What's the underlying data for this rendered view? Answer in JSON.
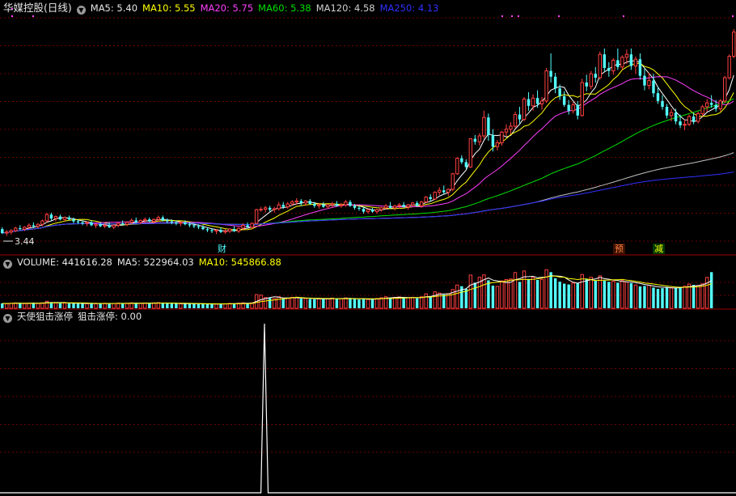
{
  "colors": {
    "bg": "#000000",
    "grid": "#6e0000",
    "separator": "#a00000",
    "up": "#ff4040",
    "down": "#54ffff",
    "ma5": "#ffffff",
    "ma10": "#ffff00",
    "ma20": "#ff40ff",
    "ma60": "#00e000",
    "ma120": "#c0c0c0",
    "ma250": "#3030ff",
    "signal": "#ffffff"
  },
  "price_panel": {
    "title": "华媒控股(日线)",
    "icon": "chevron-down-icon",
    "ma_labels": [
      {
        "text": "MA5: 5.40",
        "color": "#e6e6e6"
      },
      {
        "text": "MA10: 5.55",
        "color": "#ffff00"
      },
      {
        "text": "MA20: 5.75",
        "color": "#ff40ff"
      },
      {
        "text": "MA60: 5.38",
        "color": "#00e000"
      },
      {
        "text": "MA120: 4.58",
        "color": "#d0d0d0"
      },
      {
        "text": "MA250: 4.13",
        "color": "#3030ff"
      }
    ],
    "low_label": "3.44",
    "tags": [
      {
        "text": "财",
        "color": "#54ffff",
        "bg": "#000000",
        "index": 49
      },
      {
        "text": "预",
        "color": "#ff8040",
        "bg": "#3a1000",
        "index": 138
      },
      {
        "text": "减",
        "color": "#ffff00",
        "bg": "#003a00",
        "index": 147
      }
    ]
  },
  "volume_panel": {
    "labels": [
      {
        "text": "VOLUME: 441616.28",
        "color": "#e6e6e6"
      },
      {
        "text": "MA5: 522964.03",
        "color": "#e6e6e6"
      },
      {
        "text": "MA10: 545866.88",
        "color": "#ffff00"
      }
    ]
  },
  "indicator_panel": {
    "name": "天使狙击涨停",
    "labels": [
      {
        "text": "狙击涨停: 0.00",
        "color": "#e6e6e6"
      }
    ]
  },
  "chart_data": {
    "type": "candlestick",
    "ylim": [
      3.3,
      8.0
    ],
    "candles": [
      [
        3.58,
        3.62,
        3.48,
        3.5
      ],
      [
        3.5,
        3.56,
        3.44,
        3.52
      ],
      [
        3.52,
        3.58,
        3.47,
        3.55
      ],
      [
        3.55,
        3.63,
        3.52,
        3.6
      ],
      [
        3.6,
        3.66,
        3.56,
        3.58
      ],
      [
        3.58,
        3.64,
        3.54,
        3.62
      ],
      [
        3.62,
        3.7,
        3.58,
        3.66
      ],
      [
        3.66,
        3.72,
        3.6,
        3.64
      ],
      [
        3.64,
        3.7,
        3.6,
        3.68
      ],
      [
        3.68,
        3.78,
        3.64,
        3.75
      ],
      [
        3.75,
        3.92,
        3.72,
        3.88
      ],
      [
        3.88,
        3.92,
        3.76,
        3.8
      ],
      [
        3.8,
        3.86,
        3.74,
        3.84
      ],
      [
        3.84,
        3.88,
        3.76,
        3.78
      ],
      [
        3.78,
        3.84,
        3.74,
        3.82
      ],
      [
        3.82,
        3.86,
        3.76,
        3.78
      ],
      [
        3.78,
        3.82,
        3.7,
        3.74
      ],
      [
        3.74,
        3.78,
        3.68,
        3.72
      ],
      [
        3.72,
        3.76,
        3.66,
        3.7
      ],
      [
        3.7,
        3.74,
        3.64,
        3.72
      ],
      [
        3.72,
        3.76,
        3.64,
        3.66
      ],
      [
        3.66,
        3.7,
        3.6,
        3.68
      ],
      [
        3.68,
        3.72,
        3.62,
        3.64
      ],
      [
        3.64,
        3.7,
        3.6,
        3.66
      ],
      [
        3.66,
        3.72,
        3.6,
        3.62
      ],
      [
        3.62,
        3.68,
        3.58,
        3.66
      ],
      [
        3.66,
        3.72,
        3.62,
        3.7
      ],
      [
        3.7,
        3.76,
        3.66,
        3.68
      ],
      [
        3.68,
        3.74,
        3.64,
        3.72
      ],
      [
        3.72,
        3.8,
        3.68,
        3.76
      ],
      [
        3.76,
        3.82,
        3.7,
        3.72
      ],
      [
        3.72,
        3.78,
        3.68,
        3.76
      ],
      [
        3.76,
        3.82,
        3.72,
        3.78
      ],
      [
        3.78,
        3.82,
        3.72,
        3.74
      ],
      [
        3.74,
        3.8,
        3.7,
        3.78
      ],
      [
        3.78,
        3.86,
        3.74,
        3.82
      ],
      [
        3.82,
        3.86,
        3.74,
        3.76
      ],
      [
        3.76,
        3.8,
        3.7,
        3.74
      ],
      [
        3.74,
        3.78,
        3.68,
        3.72
      ],
      [
        3.72,
        3.76,
        3.66,
        3.7
      ],
      [
        3.7,
        3.74,
        3.64,
        3.72
      ],
      [
        3.72,
        3.76,
        3.66,
        3.68
      ],
      [
        3.68,
        3.72,
        3.62,
        3.66
      ],
      [
        3.66,
        3.7,
        3.6,
        3.64
      ],
      [
        3.64,
        3.68,
        3.58,
        3.62
      ],
      [
        3.62,
        3.66,
        3.56,
        3.58
      ],
      [
        3.58,
        3.62,
        3.52,
        3.56
      ],
      [
        3.56,
        3.6,
        3.5,
        3.54
      ],
      [
        3.54,
        3.58,
        3.48,
        3.56
      ],
      [
        3.56,
        3.62,
        3.5,
        3.52
      ],
      [
        3.52,
        3.58,
        3.48,
        3.54
      ],
      [
        3.54,
        3.6,
        3.5,
        3.58
      ],
      [
        3.58,
        3.64,
        3.52,
        3.54
      ],
      [
        3.54,
        3.62,
        3.5,
        3.6
      ],
      [
        3.6,
        3.7,
        3.56,
        3.66
      ],
      [
        3.66,
        3.72,
        3.6,
        3.62
      ],
      [
        3.62,
        3.72,
        3.58,
        3.7
      ],
      [
        3.7,
        4.0,
        3.68,
        3.98
      ],
      [
        3.98,
        4.04,
        3.94,
        3.99
      ],
      [
        3.99,
        4.06,
        3.92,
        4.02
      ],
      [
        4.02,
        4.06,
        3.94,
        3.98
      ],
      [
        3.98,
        4.04,
        3.92,
        4.0
      ],
      [
        4.0,
        4.14,
        3.96,
        4.08
      ],
      [
        4.08,
        4.14,
        4.0,
        4.04
      ],
      [
        4.04,
        4.14,
        4.0,
        4.1
      ],
      [
        4.1,
        4.18,
        4.06,
        4.14
      ],
      [
        4.14,
        4.22,
        4.08,
        4.16
      ],
      [
        4.16,
        4.2,
        4.06,
        4.12
      ],
      [
        4.12,
        4.18,
        4.06,
        4.16
      ],
      [
        4.16,
        4.2,
        4.08,
        4.1
      ],
      [
        4.1,
        4.14,
        4.02,
        4.06
      ],
      [
        4.06,
        4.12,
        4.0,
        4.08
      ],
      [
        4.08,
        4.14,
        4.02,
        4.04
      ],
      [
        4.04,
        4.1,
        4.0,
        4.08
      ],
      [
        4.08,
        4.14,
        4.02,
        4.1
      ],
      [
        4.1,
        4.16,
        4.04,
        4.06
      ],
      [
        4.06,
        4.12,
        4.02,
        4.08
      ],
      [
        4.08,
        4.18,
        4.04,
        4.14
      ],
      [
        4.14,
        4.18,
        4.04,
        4.06
      ],
      [
        4.06,
        4.1,
        3.98,
        4.02
      ],
      [
        4.02,
        4.06,
        3.96,
        4.0
      ],
      [
        4.0,
        4.04,
        3.9,
        3.94
      ],
      [
        3.94,
        4.0,
        3.9,
        3.98
      ],
      [
        3.98,
        4.02,
        3.92,
        3.94
      ],
      [
        3.94,
        4.0,
        3.9,
        3.98
      ],
      [
        3.98,
        4.04,
        3.94,
        4.02
      ],
      [
        4.02,
        4.1,
        3.98,
        4.06
      ],
      [
        4.06,
        4.14,
        4.0,
        4.02
      ],
      [
        4.02,
        4.08,
        3.96,
        4.06
      ],
      [
        4.06,
        4.12,
        4.0,
        4.08
      ],
      [
        4.08,
        4.14,
        4.02,
        4.04
      ],
      [
        4.04,
        4.1,
        3.98,
        4.08
      ],
      [
        4.08,
        4.14,
        4.04,
        4.12
      ],
      [
        4.12,
        4.16,
        4.04,
        4.06
      ],
      [
        4.06,
        4.16,
        4.02,
        4.14
      ],
      [
        4.14,
        4.26,
        4.12,
        4.24
      ],
      [
        4.24,
        4.3,
        4.16,
        4.2
      ],
      [
        4.2,
        4.36,
        4.18,
        4.34
      ],
      [
        4.34,
        4.44,
        4.28,
        4.38
      ],
      [
        4.38,
        4.48,
        4.3,
        4.34
      ],
      [
        4.34,
        4.42,
        4.26,
        4.4
      ],
      [
        4.4,
        4.74,
        4.36,
        4.72
      ],
      [
        4.72,
        5.06,
        4.7,
        5.04
      ],
      [
        5.04,
        5.1,
        4.92,
        4.96
      ],
      [
        4.96,
        5.02,
        4.82,
        4.86
      ],
      [
        4.86,
        5.46,
        4.84,
        5.44
      ],
      [
        5.44,
        5.52,
        5.32,
        5.38
      ],
      [
        5.38,
        5.56,
        5.3,
        5.5
      ],
      [
        5.5,
        6.02,
        5.44,
        5.88
      ],
      [
        5.88,
        5.96,
        5.4,
        5.52
      ],
      [
        5.52,
        5.64,
        5.18,
        5.28
      ],
      [
        5.28,
        5.42,
        5.2,
        5.36
      ],
      [
        5.36,
        5.6,
        5.3,
        5.58
      ],
      [
        5.58,
        5.74,
        5.5,
        5.64
      ],
      [
        5.64,
        5.78,
        5.54,
        5.7
      ],
      [
        5.7,
        6.0,
        5.66,
        5.94
      ],
      [
        5.94,
        6.1,
        5.76,
        5.84
      ],
      [
        5.84,
        6.3,
        5.8,
        6.26
      ],
      [
        6.26,
        6.4,
        6.02,
        6.12
      ],
      [
        6.12,
        6.36,
        6.02,
        6.28
      ],
      [
        6.28,
        6.44,
        6.08,
        6.16
      ],
      [
        6.16,
        6.3,
        6.04,
        6.22
      ],
      [
        6.22,
        6.9,
        6.18,
        6.84
      ],
      [
        6.84,
        7.2,
        6.6,
        6.72
      ],
      [
        6.72,
        6.8,
        6.38,
        6.48
      ],
      [
        6.48,
        6.56,
        6.24,
        6.32
      ],
      [
        6.32,
        6.42,
        6.1,
        6.14
      ],
      [
        6.14,
        6.24,
        5.94,
        6.02
      ],
      [
        6.02,
        6.2,
        5.96,
        6.14
      ],
      [
        6.14,
        6.22,
        5.84,
        5.92
      ],
      [
        5.92,
        6.68,
        5.9,
        6.6
      ],
      [
        6.6,
        6.76,
        6.42,
        6.52
      ],
      [
        6.52,
        6.84,
        6.46,
        6.78
      ],
      [
        6.78,
        6.92,
        6.6,
        6.7
      ],
      [
        6.7,
        7.24,
        6.66,
        7.18
      ],
      [
        7.18,
        7.3,
        6.82,
        6.9
      ],
      [
        6.9,
        7.02,
        6.72,
        6.84
      ],
      [
        6.84,
        7.1,
        6.76,
        7.06
      ],
      [
        7.06,
        7.3,
        6.86,
        6.92
      ],
      [
        6.92,
        7.16,
        6.86,
        7.12
      ],
      [
        7.12,
        7.28,
        6.98,
        7.18
      ],
      [
        7.18,
        7.3,
        6.86,
        6.94
      ],
      [
        6.94,
        7.14,
        6.78,
        7.08
      ],
      [
        7.08,
        7.2,
        6.66,
        6.74
      ],
      [
        6.74,
        6.9,
        6.44,
        6.54
      ],
      [
        6.54,
        6.8,
        6.46,
        6.64
      ],
      [
        6.64,
        6.78,
        6.3,
        6.38
      ],
      [
        6.38,
        6.52,
        6.16,
        6.22
      ],
      [
        6.22,
        6.34,
        6.04,
        6.1
      ],
      [
        6.1,
        6.16,
        5.86,
        5.92
      ],
      [
        5.92,
        6.06,
        5.8,
        5.98
      ],
      [
        5.98,
        6.06,
        5.74,
        5.8
      ],
      [
        5.8,
        5.94,
        5.66,
        5.72
      ],
      [
        5.72,
        5.84,
        5.62,
        5.74
      ],
      [
        5.74,
        5.94,
        5.7,
        5.9
      ],
      [
        5.9,
        5.98,
        5.74,
        5.8
      ],
      [
        5.8,
        6.0,
        5.76,
        5.96
      ],
      [
        5.96,
        6.14,
        5.9,
        6.1
      ],
      [
        6.1,
        6.26,
        6.0,
        6.18
      ],
      [
        6.18,
        6.34,
        6.08,
        6.14
      ],
      [
        6.14,
        6.24,
        6.0,
        6.06
      ],
      [
        6.06,
        6.26,
        6.0,
        6.22
      ],
      [
        6.22,
        6.74,
        6.18,
        6.7
      ],
      [
        6.7,
        7.18,
        6.66,
        7.14
      ],
      [
        7.14,
        7.7,
        7.1,
        7.64
      ]
    ],
    "volume": [
      50,
      48,
      52,
      55,
      50,
      47,
      53,
      58,
      50,
      56,
      72,
      60,
      55,
      52,
      54,
      50,
      48,
      52,
      50,
      48,
      50,
      46,
      49,
      52,
      48,
      50,
      53,
      50,
      52,
      56,
      52,
      50,
      54,
      52,
      55,
      58,
      52,
      50,
      48,
      50,
      46,
      48,
      45,
      47,
      44,
      46,
      42,
      45,
      44,
      48,
      46,
      50,
      48,
      52,
      56,
      50,
      56,
      140,
      135,
      110,
      105,
      100,
      118,
      100,
      104,
      112,
      108,
      98,
      100,
      95,
      92,
      98,
      96,
      100,
      104,
      98,
      100,
      106,
      98,
      95,
      90,
      95,
      92,
      98,
      100,
      108,
      118,
      110,
      112,
      116,
      104,
      108,
      112,
      102,
      118,
      148,
      124,
      168,
      156,
      140,
      150,
      192,
      238,
      226,
      198,
      340,
      262,
      318,
      342,
      286,
      232,
      224,
      280,
      294,
      300,
      366,
      270,
      382,
      300,
      318,
      290,
      296,
      394,
      370,
      308,
      272,
      252,
      244,
      258,
      256,
      346,
      298,
      318,
      286,
      332,
      282,
      270,
      276,
      262,
      284,
      268,
      258,
      238,
      224,
      228,
      236,
      212,
      198,
      206,
      218,
      210,
      208,
      214,
      226,
      248,
      240,
      234,
      250,
      316,
      370
    ],
    "signal": [
      [
        58.5,
        0
      ],
      [
        59.3,
        1
      ],
      [
        60.1,
        0
      ]
    ]
  }
}
